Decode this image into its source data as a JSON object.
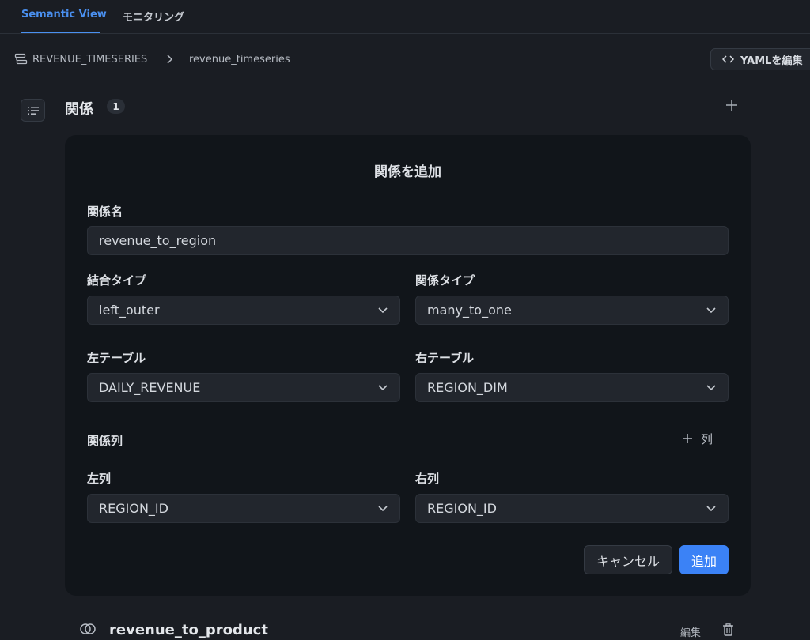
{
  "tabs": [
    {
      "label": "Semantic View"
    },
    {
      "label": "モニタリング"
    }
  ],
  "breadcrumb": {
    "view_name": "REVENUE_TIMESERIES",
    "page": "revenue_timeseries"
  },
  "toolbar": {
    "yaml_edit_label": "YAMLを編集"
  },
  "section": {
    "title": "関係",
    "count": "1"
  },
  "dialog": {
    "title": "関係を追加",
    "name_label": "関係名",
    "name_value": "revenue_to_region",
    "join_type_label": "結合タイプ",
    "join_type_value": "left_outer",
    "relation_type_label": "関係タイプ",
    "relation_type_value": "many_to_one",
    "left_table_label": "左テーブル",
    "left_table_value": "DAILY_REVENUE",
    "right_table_label": "右テーブル",
    "right_table_value": "REGION_DIM",
    "columns_label": "関係列",
    "add_column_label": "列",
    "left_column_label": "左列",
    "left_column_value": "REGION_ID",
    "right_column_label": "右列",
    "right_column_value": "REGION_ID",
    "cancel_label": "キャンセル",
    "submit_label": "追加"
  },
  "relationships": [
    {
      "name": "revenue_to_product",
      "edit_label": "編集"
    }
  ],
  "colors": {
    "accent": "#4a90f0",
    "primary_button": "#3b82f6",
    "background": "#1a1d23",
    "panel": "#11151a"
  }
}
